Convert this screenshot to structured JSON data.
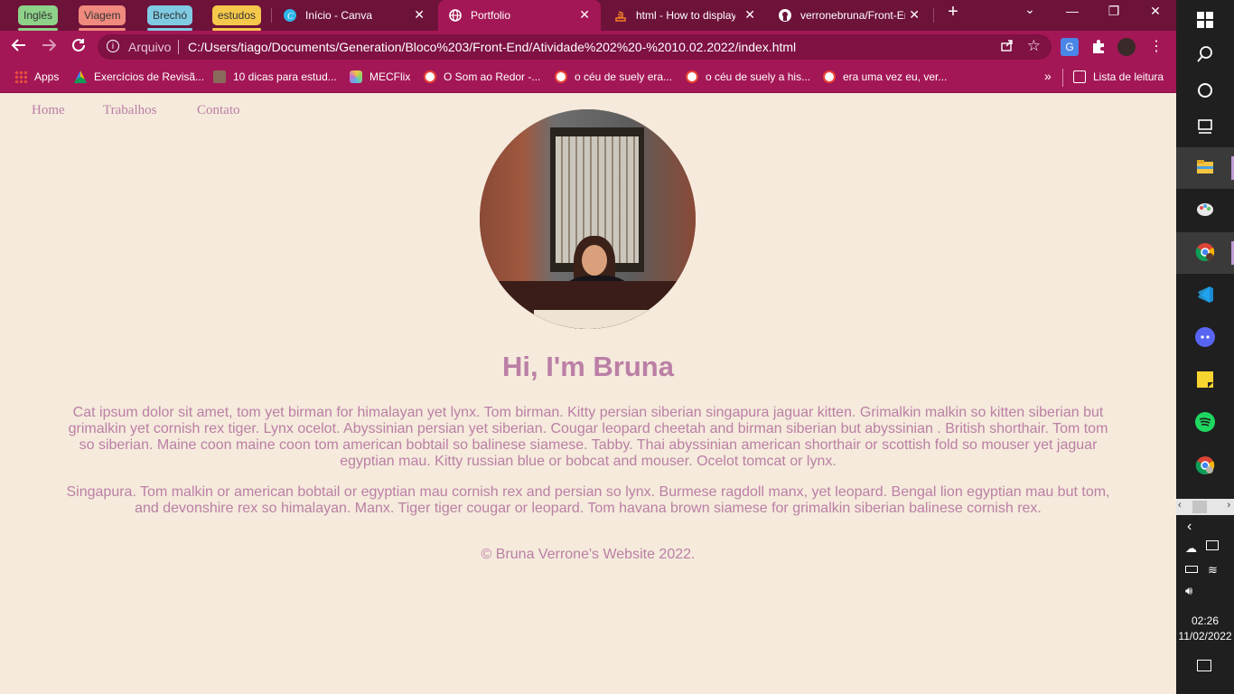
{
  "tab_groups": [
    {
      "label": "Inglês",
      "color": "#8ed28a"
    },
    {
      "label": "Viagem",
      "color": "#f08a7e"
    },
    {
      "label": "Brechó",
      "color": "#7fcbe4"
    },
    {
      "label": "estudos",
      "color": "#f5c84b"
    }
  ],
  "tabs": [
    {
      "title": "Início - Canva",
      "icon": "canva-icon",
      "active": false
    },
    {
      "title": "Portfolio",
      "icon": "globe-icon",
      "active": true
    },
    {
      "title": "html - How to display",
      "icon": "stackoverflow-icon",
      "active": false
    },
    {
      "title": "verronebruna/Front-En",
      "icon": "github-icon",
      "active": false
    }
  ],
  "window_controls": {
    "new_tab": "+",
    "dropdown": "⌄",
    "minimize": "—",
    "restore": "❐",
    "close": "✕"
  },
  "omnibox": {
    "scheme_label": "Arquivo",
    "url": "C:/Users/tiago/Documents/Generation/Bloco%203/Front-End/Atividade%202%20-%2010.02.2022/index.html"
  },
  "bookmarks": [
    {
      "label": "Apps",
      "icon": "apps-grid-icon"
    },
    {
      "label": "Exercícios de Revisã...",
      "icon": "google-drive-icon"
    },
    {
      "label": "10 dicas para estud...",
      "icon": "page-icon"
    },
    {
      "label": "MECFlix",
      "icon": "mecflix-icon"
    },
    {
      "label": "O Som ao Redor -...",
      "icon": "google-icon"
    },
    {
      "label": "o céu de suely era...",
      "icon": "google-icon"
    },
    {
      "label": "o céu de suely a his...",
      "icon": "google-icon"
    },
    {
      "label": "era uma vez eu, ver...",
      "icon": "google-icon"
    }
  ],
  "bookmarks_more": "»",
  "reading_list": "Lista de leitura",
  "site": {
    "nav": [
      "Home",
      "Trabalhos",
      "Contato"
    ],
    "heading": "Hi, I'm Bruna",
    "paragraphs": [
      "Cat ipsum dolor sit amet, tom yet birman for himalayan yet lynx. Tom birman. Kitty persian siberian singapura jaguar kitten. Grimalkin malkin so kitten siberian but grimalkin yet cornish rex tiger. Lynx ocelot. Abyssinian persian yet siberian. Cougar leopard cheetah and birman siberian but abyssinian . British shorthair. Tom tom so siberian. Maine coon maine coon tom american bobtail so balinese siamese. Tabby. Thai abyssinian american shorthair or scottish fold so mouser yet jaguar egyptian mau. Kitty russian blue or bobcat and mouser. Ocelot tomcat or lynx.",
      "Singapura. Tom malkin or american bobtail or egyptian mau cornish rex and persian so lynx. Burmese ragdoll manx, yet leopard. Bengal lion egyptian mau but tom, and devonshire rex so himalayan. Manx. Tiger tiger cougar or leopard. Tom havana brown siamese for grimalkin siberian balinese cornish rex."
    ],
    "footer": "© Bruna Verrone's Website 2022.",
    "accent_color": "#bb7fa5",
    "background_color": "#f5eadc"
  },
  "taskbar": {
    "apps": [
      "windows-start-icon",
      "search-icon",
      "cortana-icon",
      "task-view-icon",
      "file-explorer-icon",
      "paint-icon",
      "chrome-profile-icon",
      "vscode-icon",
      "discord-icon",
      "sticky-notes-icon",
      "spotify-icon",
      "chrome-icon"
    ],
    "time": "02:26",
    "date": "11/02/2022"
  },
  "theme": {
    "tabstrip": "#6d1239",
    "toolbar": "#a41756"
  }
}
